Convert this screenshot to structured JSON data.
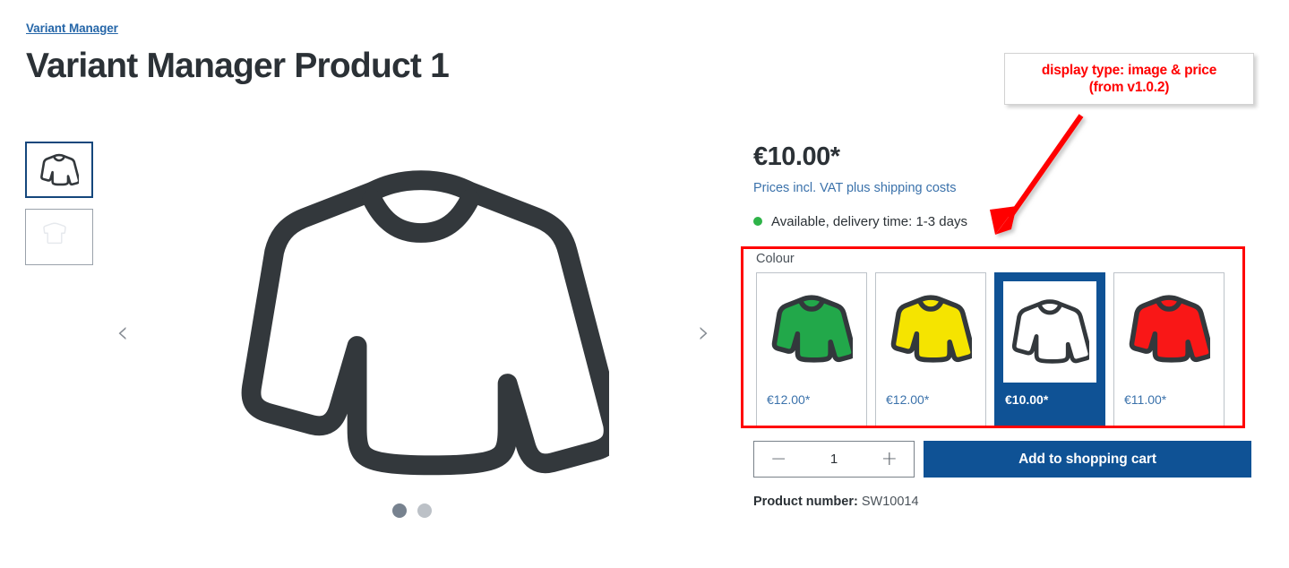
{
  "breadcrumb": {
    "label": "Variant Manager"
  },
  "page_title": "Variant Manager Product 1",
  "gallery": {
    "thumbnails": [
      {
        "name": "sweater-white-thumb",
        "state": "active"
      },
      {
        "name": "placeholder-thumb",
        "state": "inactive"
      }
    ],
    "prev_arrow": "‹",
    "next_arrow": "›",
    "dots": [
      "active",
      "inactive"
    ]
  },
  "buybox": {
    "price": "€10.00*",
    "tax_note": "Prices incl. VAT plus shipping costs",
    "availability": "Available, delivery time: 1-3 days",
    "availability_color": "#2eb348"
  },
  "variants": {
    "label": "Colour",
    "options": [
      {
        "color_name": "green",
        "hex": "#22a84a",
        "price": "€12.00*",
        "selected": false
      },
      {
        "color_name": "yellow",
        "hex": "#f5e400",
        "price": "€12.00*",
        "selected": false
      },
      {
        "color_name": "white",
        "hex": "#ffffff",
        "price": "€10.00*",
        "selected": true
      },
      {
        "color_name": "red",
        "hex": "#f91717",
        "price": "€11.00*",
        "selected": false
      }
    ],
    "selected_index": 2,
    "highlight_border_color": "#ff0000"
  },
  "annotation": {
    "line1": "display type: image & price",
    "line2": "(from v1.0.2)",
    "color": "#ff0000"
  },
  "buy_row": {
    "qty_minus": "−",
    "qty_value": "1",
    "qty_plus": "+",
    "cart_button": "Add to shopping cart",
    "accent_color": "#0f5295"
  },
  "product_number": {
    "label": "Product number:",
    "value": "SW10014"
  }
}
